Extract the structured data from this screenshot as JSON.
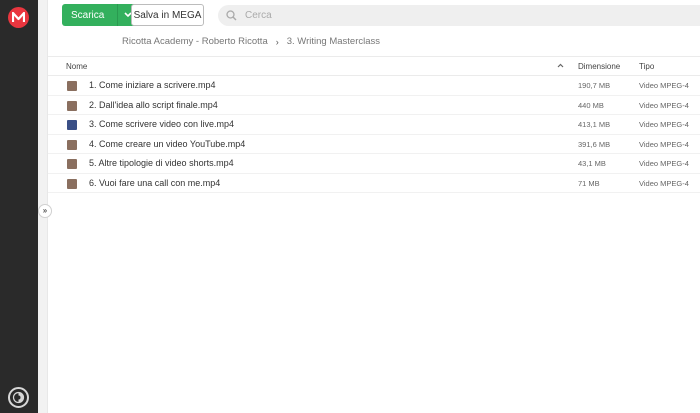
{
  "toolbar": {
    "download_label": "Scarica",
    "save_label": "Salva in MEGA",
    "search_placeholder": "Cerca"
  },
  "breadcrumb": {
    "root": "Ricotta Academy - Roberto Ricotta",
    "current": "3. Writing Masterclass"
  },
  "table": {
    "headers": {
      "name": "Nome",
      "size": "Dimensione",
      "type": "Tipo"
    },
    "rows": [
      {
        "name": "1. Come iniziare a scrivere.mp4",
        "size": "190,7 MB",
        "type": "Video MPEG-4",
        "thumb": "#8a6f5f"
      },
      {
        "name": "2. Dall'idea allo script finale.mp4",
        "size": "440 MB",
        "type": "Video MPEG-4",
        "thumb": "#8a6f5f"
      },
      {
        "name": "3. Come scrivere video con live.mp4",
        "size": "413,1 MB",
        "type": "Video MPEG-4",
        "thumb": "#3a4f86"
      },
      {
        "name": "4. Come creare un video YouTube.mp4",
        "size": "391,6 MB",
        "type": "Video MPEG-4",
        "thumb": "#8a6f5f"
      },
      {
        "name": "5. Altre tipologie di video shorts.mp4",
        "size": "43,1 MB",
        "type": "Video MPEG-4",
        "thumb": "#8a6f5f"
      },
      {
        "name": "6. Vuoi fare una call con me.mp4",
        "size": "71 MB",
        "type": "Video MPEG-4",
        "thumb": "#8a6f5f"
      }
    ]
  },
  "colors": {
    "accent_green": "#33b05d",
    "brand_red": "#e9363f",
    "rail": "#2a2a2a"
  }
}
